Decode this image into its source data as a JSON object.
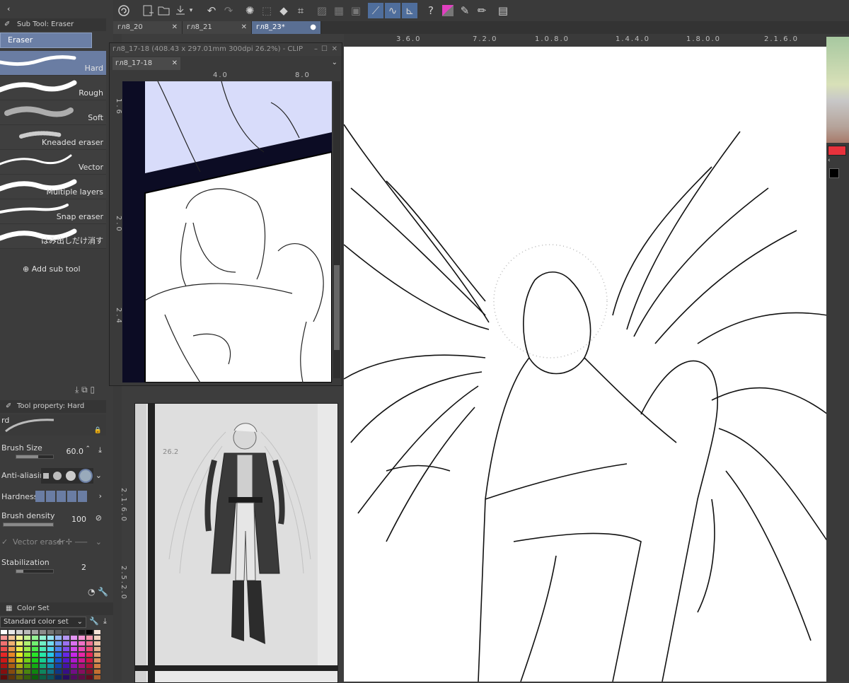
{
  "toolbar": {
    "icons": [
      "app-logo-icon",
      "new-icon",
      "open-icon",
      "save-icon",
      "undo-icon",
      "redo-icon",
      "loading-icon",
      "select-icon",
      "fill-icon",
      "transform-icon",
      "ruler-icon",
      "grid-icon",
      "frame-icon",
      "snap-ruler-icon",
      "snap-curve-icon",
      "snap-grid-icon",
      "help-icon",
      "color-mode-icon",
      "pen-icon",
      "pencil-icon",
      "tablet-icon"
    ]
  },
  "tabs": [
    {
      "label": "гл8_20"
    },
    {
      "label": "гл8_21"
    },
    {
      "label": "гл8_23*"
    }
  ],
  "subtool_panel": {
    "title": "Sub Tool: Eraser",
    "group": "Eraser",
    "items": [
      {
        "label": "Hard"
      },
      {
        "label": "Rough"
      },
      {
        "label": "Soft"
      },
      {
        "label": "Kneaded eraser"
      },
      {
        "label": "Vector"
      },
      {
        "label": "Multiple layers"
      },
      {
        "label": "Snap eraser"
      },
      {
        "label": "はみ出しだけ消す"
      }
    ],
    "add_label": "Add sub tool"
  },
  "tool_property": {
    "title": "Tool property: Hard",
    "preview_label": "rd",
    "brush_size_label": "Brush Size",
    "brush_size_value": "60.0",
    "brush_size_fill": 0.6,
    "antialias_label": "Anti-aliasing",
    "hardness_label": "Hardness",
    "density_label": "Brush density",
    "density_value": "100",
    "density_fill": 1.0,
    "vector_label": "Vector eraser",
    "stabilization_label": "Stabilization",
    "stabilization_value": "2",
    "stabilization_fill": 0.2
  },
  "color_set": {
    "title": "Color Set",
    "select_value": "Standard color set"
  },
  "subwindow": {
    "title": "гл8_17-18 (408.43 x 297.01mm 300dpi 26.2%) - CLIP",
    "tab": "гл8_17-18",
    "ruler_labels": [
      "4.0",
      "8.0"
    ],
    "v_ruler_labels": [
      "1.6",
      "2.0",
      "2.4"
    ]
  },
  "reference": {
    "zoom_label": "26.2"
  },
  "main_ruler": {
    "labels": [
      "3.6.0",
      "7.2.0",
      "1.0.8.0",
      "1.4.4.0",
      "1.8.0.0",
      "2.1.6.0"
    ],
    "v_labels": [
      "2.1.6.0",
      "2.5.2.0"
    ]
  },
  "colors": {
    "accent": "#5a6f93",
    "main_red": "#e8323c",
    "sub_black": "#000000"
  }
}
